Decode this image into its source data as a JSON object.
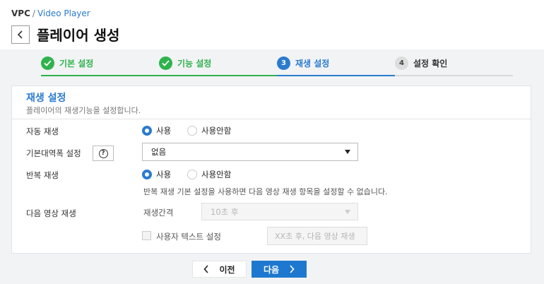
{
  "breadcrumb": {
    "root": "VPC",
    "separator": "/",
    "current": "Video Player"
  },
  "page": {
    "title": "플레이어 생성"
  },
  "steps": [
    {
      "label": "기본 설정",
      "state": "done"
    },
    {
      "label": "기능 설정",
      "state": "done"
    },
    {
      "label": "재생 설정",
      "state": "current",
      "number": "3"
    },
    {
      "label": "설정 확인",
      "state": "todo",
      "number": "4"
    }
  ],
  "panel": {
    "title": "재생 설정",
    "description": "플레이어의 재생기능을 설정합니다.",
    "autoplay": {
      "label": "자동 재생",
      "opt_on": "사용",
      "opt_off": "사용안함",
      "selected": "사용"
    },
    "bandwidth": {
      "label": "기본대역폭 설정",
      "value": "없음"
    },
    "repeat": {
      "label": "반복 재생",
      "opt_on": "사용",
      "opt_off": "사용안함",
      "selected": "사용",
      "note": "반복 재생 기본 설정을 사용하면 다음 영상 재생 항목을 설정할 수 없습니다."
    },
    "next_video": {
      "label": "다음 영상 재생",
      "interval_label": "재생간격",
      "interval_value": "10초 후",
      "custom_text_label": "사용자 텍스트 설정",
      "custom_text_placeholder": "XX초 후, 다음 영상 재생"
    }
  },
  "buttons": {
    "prev": "이전",
    "next": "다음"
  },
  "colors": {
    "accent": "#2a7bcf",
    "done": "#2fb34d",
    "primary_button": "#1f78d0",
    "background": "#f2f3f5"
  }
}
